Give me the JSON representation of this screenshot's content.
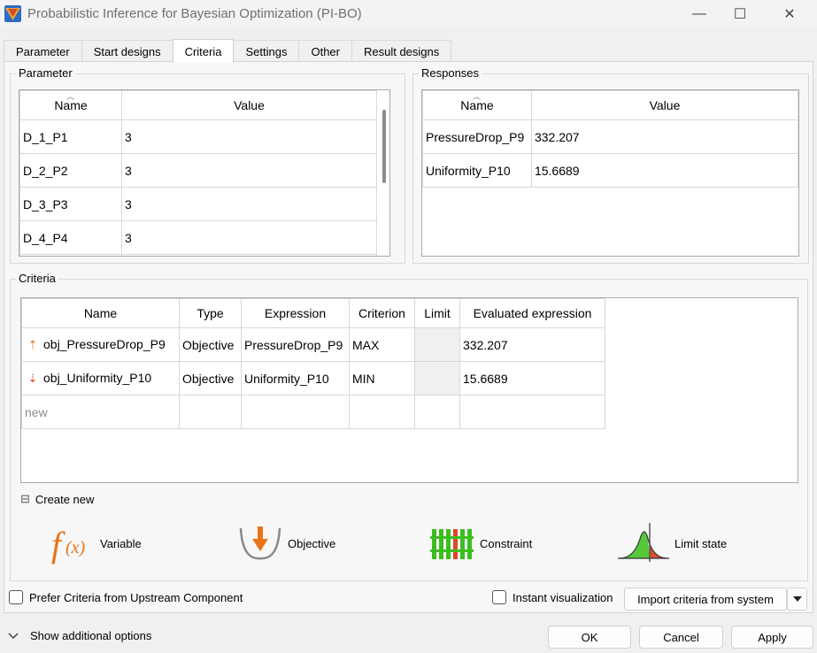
{
  "window": {
    "title": "Probabilistic Inference for Bayesian Optimization (PI-BO)",
    "minimize_glyph": "—",
    "maximize_glyph": "☐",
    "close_glyph": "✕"
  },
  "tabs": [
    {
      "label": "Parameter"
    },
    {
      "label": "Start designs"
    },
    {
      "label": "Criteria",
      "active": true
    },
    {
      "label": "Settings"
    },
    {
      "label": "Other"
    },
    {
      "label": "Result designs"
    }
  ],
  "parameter_group": {
    "title": "Parameter",
    "columns": [
      "Name",
      "Value"
    ],
    "rows": [
      {
        "name": "D_1_P1",
        "value": "3"
      },
      {
        "name": "D_2_P2",
        "value": "3"
      },
      {
        "name": "D_3_P3",
        "value": "3"
      },
      {
        "name": "D_4_P4",
        "value": "3"
      }
    ]
  },
  "responses_group": {
    "title": "Responses",
    "columns": [
      "Name",
      "Value"
    ],
    "rows": [
      {
        "name": "PressureDrop_P9",
        "value": "332.207"
      },
      {
        "name": "Uniformity_P10",
        "value": "15.6689"
      }
    ]
  },
  "criteria_group": {
    "title": "Criteria",
    "columns": [
      "Name",
      "Type",
      "Expression",
      "Criterion",
      "Limit",
      "Evaluated expression"
    ],
    "rows": [
      {
        "icon": "arrow-up-icon",
        "name": "obj_PressureDrop_P9",
        "type": "Objective",
        "expression": "PressureDrop_P9",
        "criterion": "MAX",
        "limit": "",
        "evaluated": "332.207"
      },
      {
        "icon": "arrow-down-icon",
        "name": "obj_Uniformity_P10",
        "type": "Objective",
        "expression": "Uniformity_P10",
        "criterion": "MIN",
        "limit": "",
        "evaluated": "15.6689"
      }
    ],
    "new_row_label": "new"
  },
  "create_new": {
    "toggle_glyph": "⊟",
    "label": "Create new",
    "items": [
      {
        "label": "Variable",
        "icon": "function-icon"
      },
      {
        "label": "Objective",
        "icon": "objective-icon"
      },
      {
        "label": "Constraint",
        "icon": "constraint-icon"
      },
      {
        "label": "Limit state",
        "icon": "limit-state-icon"
      }
    ]
  },
  "options": {
    "prefer_upstream_label": "Prefer Criteria from Upstream Component",
    "prefer_upstream_checked": false,
    "instant_visualization_label": "Instant visualization",
    "instant_visualization_checked": false,
    "import_label": "Import criteria from system"
  },
  "footer": {
    "show_additional_label": "Show additional options",
    "ok_label": "OK",
    "cancel_label": "Cancel",
    "apply_label": "Apply"
  },
  "colors": {
    "objective_arrow": "#e8731a",
    "constraint_green": "#3bbf1f",
    "constraint_red": "#e0462a",
    "limit_green": "#55c83a",
    "limit_red": "#e04a2a"
  }
}
